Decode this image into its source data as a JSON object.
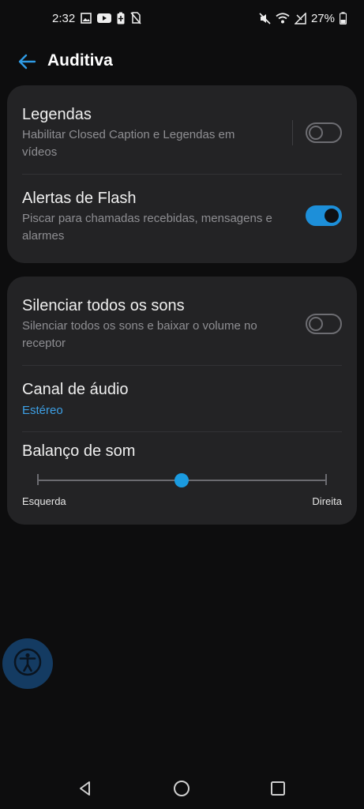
{
  "status_bar": {
    "time": "2:32",
    "battery_percent": "27%",
    "left_icons": [
      "image-icon",
      "youtube-icon",
      "battery-saver-icon",
      "no-sim-icon"
    ],
    "right_icons": [
      "mute-icon",
      "wifi-icon",
      "signal-icon",
      "battery-icon"
    ]
  },
  "app_bar": {
    "title": "Auditiva",
    "back_icon": "back-arrow-icon"
  },
  "sections": [
    {
      "items": [
        {
          "title": "Legendas",
          "subtitle_line1": "Habilitar Closed Caption e Legendas em",
          "subtitle_line2": "vídeos",
          "toggle": false
        },
        {
          "title": "Alertas de Flash",
          "subtitle_line1": "Piscar para chamadas recebidas, mensagens e",
          "subtitle_line2": "alarmes",
          "toggle": true
        }
      ]
    },
    {
      "items": [
        {
          "title": "Silenciar todos os sons",
          "subtitle_line1": "Silenciar todos os sons e baixar o volume no",
          "subtitle_line2": "receptor",
          "toggle": false
        },
        {
          "title": "Canal de áudio",
          "value": "Estéreo"
        },
        {
          "title": "Balanço de som",
          "left_label": "Esquerda",
          "right_label": "Direita",
          "balance_fraction": 0.5
        }
      ]
    }
  ],
  "accessibility_button": {
    "icon": "accessibility-icon"
  },
  "nav_bar": {
    "icons": [
      "back-triangle-icon",
      "home-circle-icon",
      "recents-square-icon"
    ]
  },
  "colors": {
    "accent": "#1d8fd9",
    "card": "#232325",
    "background": "#0d0d0e"
  }
}
